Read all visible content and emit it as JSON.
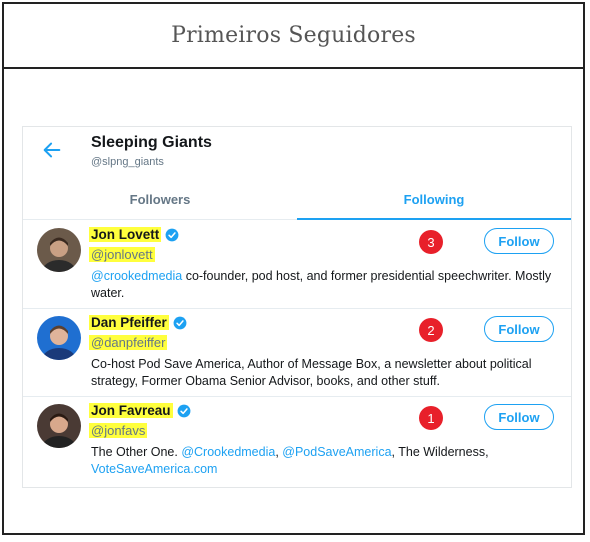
{
  "frame": {
    "title": "Primeiros Seguidores"
  },
  "account": {
    "name": "Sleeping Giants",
    "handle": "@slpng_giants"
  },
  "tabs": [
    {
      "label": "Followers",
      "active": false
    },
    {
      "label": "Following",
      "active": true
    }
  ],
  "colors": {
    "accent": "#1da1f2",
    "highlight": "#ffff3d",
    "badge": "#e8202a"
  },
  "users": [
    {
      "name": "Jon Lovett",
      "handle": "@jonlovett",
      "verified": true,
      "badge": "3",
      "follow_label": "Follow",
      "bio_parts": [
        {
          "text": "@crookedmedia",
          "link": true
        },
        {
          "text": " co-founder, pod host, and former presidential speechwriter. Mostly water.",
          "link": false
        }
      ]
    },
    {
      "name": "Dan Pfeiffer",
      "handle": "@danpfeiffer",
      "verified": true,
      "badge": "2",
      "follow_label": "Follow",
      "bio_parts": [
        {
          "text": "Co-host Pod Save America, Author of Message Box, a newsletter about political strategy, Former Obama Senior Advisor, books, and other stuff.",
          "link": false
        }
      ]
    },
    {
      "name": "Jon Favreau",
      "handle": "@jonfavs",
      "verified": true,
      "badge": "1",
      "follow_label": "Follow",
      "bio_parts": [
        {
          "text": "The Other One. ",
          "link": false
        },
        {
          "text": "@Crookedmedia",
          "link": true
        },
        {
          "text": ", ",
          "link": false
        },
        {
          "text": "@PodSaveAmerica",
          "link": true
        },
        {
          "text": ", The Wilderness, ",
          "link": false
        },
        {
          "text": "VoteSaveAmerica.com",
          "link": true
        }
      ]
    }
  ]
}
